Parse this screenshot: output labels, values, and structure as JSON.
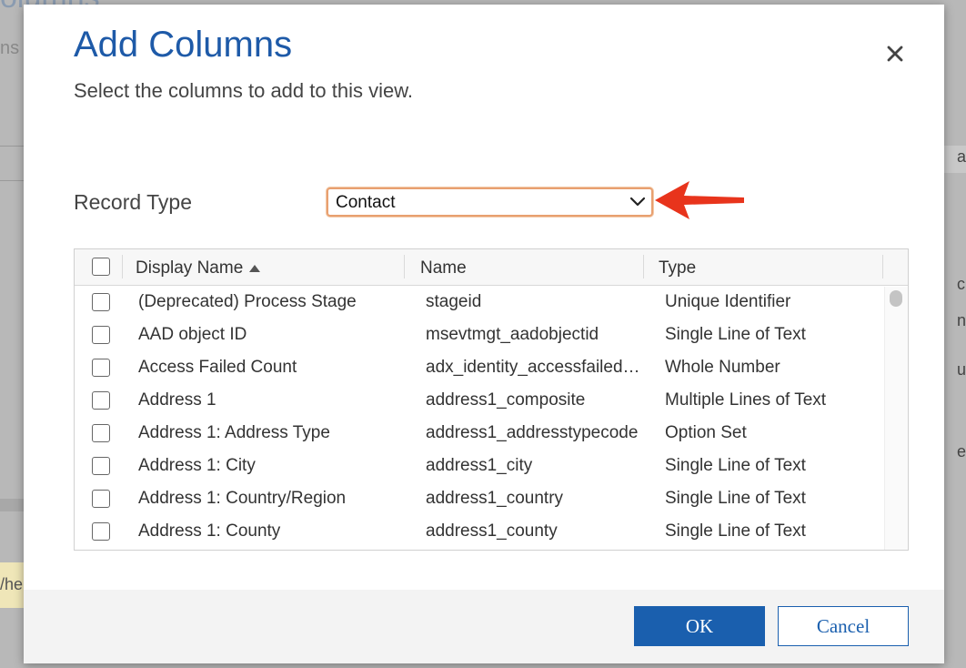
{
  "background": {
    "title_fragment": "olumns",
    "subtitle_fragment": "ns",
    "warning_fragment": "/he",
    "right_glyphs": [
      "as",
      "c",
      "n",
      "u",
      "e"
    ]
  },
  "dialog": {
    "title": "Add Columns",
    "subtitle": "Select the columns to add to this view.",
    "close_icon": "close-icon",
    "record_type": {
      "label": "Record Type",
      "selected": "Contact"
    },
    "grid": {
      "columns": [
        {
          "key": "display_name",
          "label": "Display Name",
          "sort": "ascending"
        },
        {
          "key": "name",
          "label": "Name"
        },
        {
          "key": "type",
          "label": "Type"
        }
      ],
      "rows": [
        {
          "display_name": "(Deprecated) Process Stage",
          "name": "stageid",
          "type": "Unique Identifier"
        },
        {
          "display_name": "AAD object ID",
          "name": "msevtmgt_aadobjectid",
          "type": "Single Line of Text"
        },
        {
          "display_name": "Access Failed Count",
          "name": "adx_identity_accessfailed…",
          "type": "Whole Number"
        },
        {
          "display_name": "Address 1",
          "name": "address1_composite",
          "type": "Multiple Lines of Text"
        },
        {
          "display_name": "Address 1: Address Type",
          "name": "address1_addresstypecode",
          "type": "Option Set"
        },
        {
          "display_name": "Address 1: City",
          "name": "address1_city",
          "type": "Single Line of Text"
        },
        {
          "display_name": "Address 1: Country/Region",
          "name": "address1_country",
          "type": "Single Line of Text"
        },
        {
          "display_name": "Address 1: County",
          "name": "address1_county",
          "type": "Single Line of Text"
        }
      ]
    },
    "footer": {
      "ok_label": "OK",
      "cancel_label": "Cancel"
    }
  },
  "colors": {
    "accent": "#1e5aa8",
    "button_primary": "#1a5fae",
    "select_border": "#e8a070",
    "annotation_arrow": "#e8341c"
  }
}
